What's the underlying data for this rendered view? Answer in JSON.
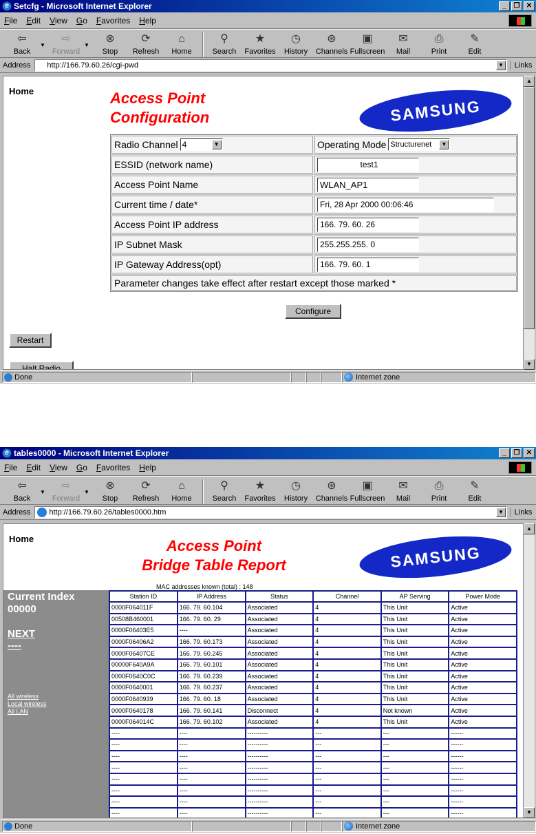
{
  "menu": [
    "File",
    "Edit",
    "View",
    "Go",
    "Favorites",
    "Help"
  ],
  "toolbar": [
    {
      "label": "Back",
      "icon": "back-arrow-icon",
      "glyph": "⇦",
      "dropdown": true,
      "disabled": false
    },
    {
      "label": "Forward",
      "icon": "forward-arrow-icon",
      "glyph": "⇨",
      "dropdown": true,
      "disabled": true
    },
    {
      "label": "Stop",
      "icon": "stop-icon",
      "glyph": "⊗"
    },
    {
      "label": "Refresh",
      "icon": "refresh-icon",
      "glyph": "⟳"
    },
    {
      "label": "Home",
      "icon": "home-icon",
      "glyph": "⌂"
    },
    {
      "label": "Search",
      "icon": "search-icon",
      "glyph": "⚲"
    },
    {
      "label": "Favorites",
      "icon": "favorites-icon",
      "glyph": "★"
    },
    {
      "label": "History",
      "icon": "history-icon",
      "glyph": "◷"
    },
    {
      "label": "Channels",
      "icon": "channels-icon",
      "glyph": "⊛"
    },
    {
      "label": "Fullscreen",
      "icon": "fullscreen-icon",
      "glyph": "▣"
    },
    {
      "label": "Mail",
      "icon": "mail-icon",
      "glyph": "✉"
    },
    {
      "label": "Print",
      "icon": "print-icon",
      "glyph": "⎙"
    },
    {
      "label": "Edit",
      "icon": "edit-icon",
      "glyph": "✎"
    }
  ],
  "window1": {
    "title": "Setcfg - Microsoft Internet Explorer",
    "address_label": "Address",
    "url": "http://166.79.60.26/cgi-pwd",
    "links_label": "Links",
    "home_label": "Home",
    "page_title_1": "Access Point",
    "page_title_2": "Configuration",
    "logo_text": "SAMSUNG",
    "form": {
      "radio_channel_label": "Radio Channel",
      "radio_channel_value": "4",
      "operating_mode_label": "Operating Mode",
      "operating_mode_value": "Structurenet",
      "essid_label": "ESSID (network name)",
      "essid_value": "test1",
      "ap_name_label": "Access Point Name",
      "ap_name_value": "WLAN_AP1",
      "time_label": "Current time / date*",
      "time_value": "Fri, 28 Apr 2000 00:06:46",
      "ip_label": "Access Point IP address",
      "ip_value": "166. 79. 60. 26",
      "mask_label": "IP Subnet Mask",
      "mask_value": "255.255.255.  0",
      "gateway_label": "IP Gateway Address(opt)",
      "gateway_value": "166. 79. 60.  1",
      "note": "Parameter changes take effect after restart except those marked *"
    },
    "configure_button": "Configure",
    "restart_button": "Restart",
    "halt_button": "Halt Radio",
    "status_text": "Done",
    "zone_text": "Internet zone"
  },
  "window2": {
    "title": "tables0000 - Microsoft Internet Explorer",
    "address_label": "Address",
    "url": "http://166.79.60.26/tables0000.htm",
    "links_label": "Links",
    "home_label": "Home",
    "page_title_1": "Access Point",
    "page_title_2": "Bridge Table Report",
    "logo_text": "SAMSUNG",
    "mac_count": "MAC addresses known (total) : 148",
    "current_index_label": "Current Index",
    "current_index_value": "00000",
    "next_link": "NEXT",
    "prev_link": "----",
    "filter_links": [
      "All wireless",
      "Local wireless",
      "All LAN"
    ],
    "table_headers": [
      "Station ID",
      "IP Address",
      "Status",
      "Channel",
      "AP Serving",
      "Power Mode"
    ],
    "table_rows": [
      [
        "0000F064011F",
        "166. 79. 60.104",
        "Associated",
        "4",
        "This Unit",
        "Active"
      ],
      [
        "00508B460001",
        "166. 79. 60. 29",
        "Associated",
        "4",
        "This Unit",
        "Active"
      ],
      [
        "0000F06403E5",
        "----",
        "Associated",
        "4",
        "This Unit",
        "Active"
      ],
      [
        "0000F06406A2",
        "166. 79. 60.173",
        "Associated",
        "4",
        "This Unit",
        "Active"
      ],
      [
        "0000F06407CE",
        "166. 79. 60.245",
        "Associated",
        "4",
        "This Unit",
        "Active"
      ],
      [
        "00000F640A9A",
        "166. 79. 60.101",
        "Associated",
        "4",
        "This Unit",
        "Active"
      ],
      [
        "0000F0640C0C",
        "166. 79. 60.239",
        "Associated",
        "4",
        "This Unit",
        "Active"
      ],
      [
        "0000F0640001",
        "166. 79. 60.237",
        "Associated",
        "4",
        "This Unit",
        "Active"
      ],
      [
        "0000F0640939",
        "166. 79. 60. 18",
        "Associated",
        "4",
        "This Unit",
        "Active"
      ],
      [
        "0000F0640178",
        "166. 79. 60.141",
        "Disconnect",
        "4",
        "Not known",
        "Active"
      ],
      [
        "0000F064014C",
        "166. 79. 60.102",
        "Associated",
        "4",
        "This Unit",
        "Active"
      ],
      [
        "----",
        "----",
        "----------",
        "---",
        "---",
        "------"
      ],
      [
        "----",
        "----",
        "----------",
        "---",
        "---",
        "------"
      ],
      [
        "----",
        "----",
        "----------",
        "---",
        "---",
        "------"
      ],
      [
        "----",
        "----",
        "----------",
        "---",
        "---",
        "------"
      ],
      [
        "----",
        "----",
        "----------",
        "---",
        "---",
        "------"
      ],
      [
        "----",
        "----",
        "----------",
        "---",
        "---",
        "------"
      ],
      [
        "----",
        "----",
        "----------",
        "---",
        "---",
        "------"
      ],
      [
        "----",
        "----",
        "----------",
        "---",
        "---",
        "------"
      ]
    ],
    "status_text": "Done",
    "zone_text": "Internet zone"
  },
  "colors": {
    "title_red": "#ff0000",
    "samsung_blue": "#1428c8",
    "table_border": "#1a1a8c",
    "titlebar": "#000080"
  }
}
